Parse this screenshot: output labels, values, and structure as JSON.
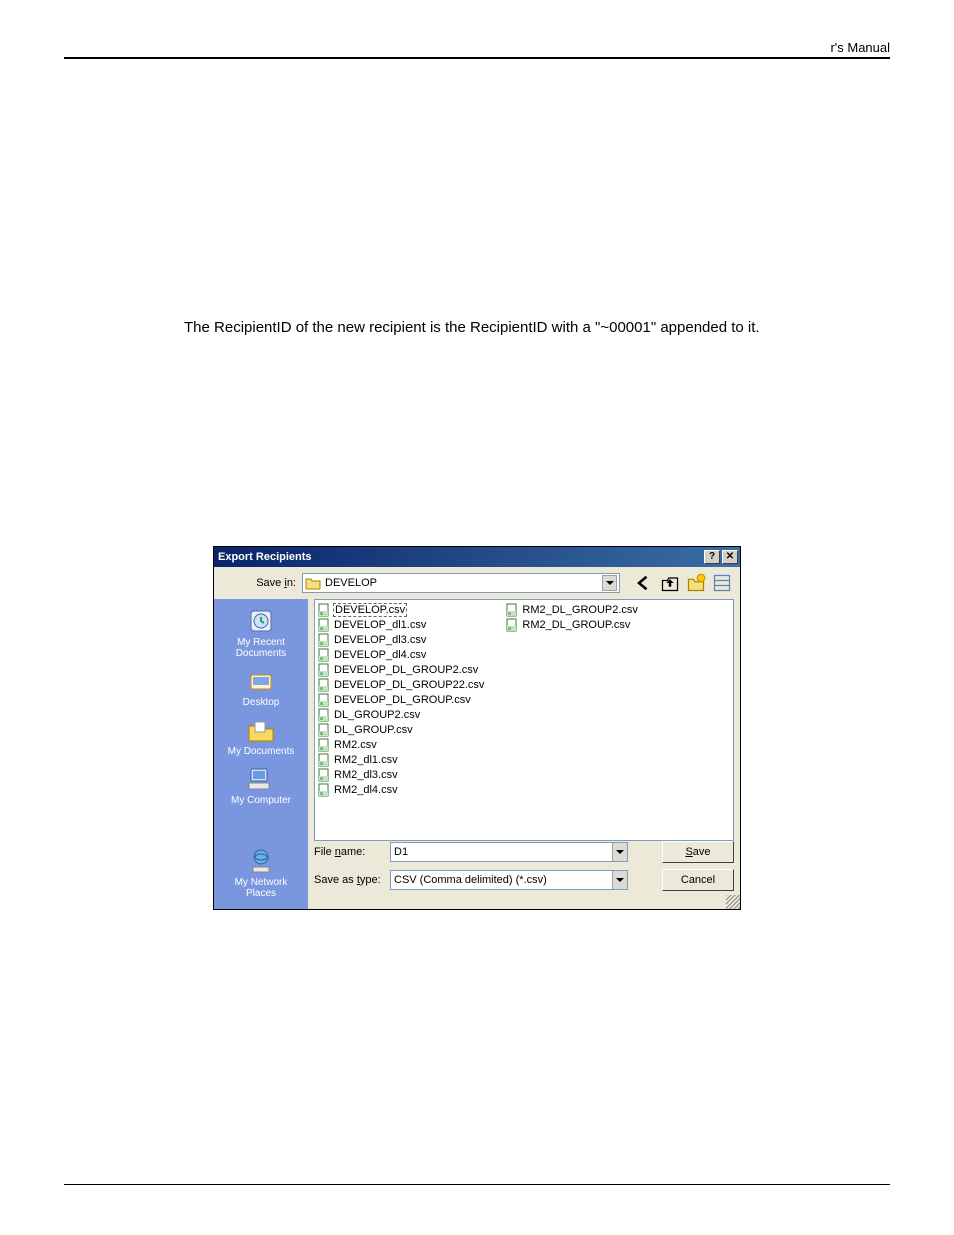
{
  "header": {
    "right_text": "r's Manual"
  },
  "body": {
    "paragraph": "The RecipientID of the new recipient is the RecipientID with a \"~00001\" appended to it."
  },
  "dialog": {
    "title": "Export Recipients",
    "save_in_label": "Save in:",
    "save_in_value": "DEVELOP",
    "sidebar": [
      {
        "label": "My Recent\nDocuments",
        "icon": "recent"
      },
      {
        "label": "Desktop",
        "icon": "desktop"
      },
      {
        "label": "My Documents",
        "icon": "documents"
      },
      {
        "label": "My Computer",
        "icon": "computer"
      }
    ],
    "sidebar_bottom": {
      "label": "My Network\nPlaces",
      "icon": "network"
    },
    "files_col1": [
      "DEVELOP.csv",
      "DEVELOP_dl1.csv",
      "DEVELOP_dl3.csv",
      "DEVELOP_dl4.csv",
      "DEVELOP_DL_GROUP2.csv",
      "DEVELOP_DL_GROUP22.csv",
      "DEVELOP_DL_GROUP.csv",
      "DL_GROUP2.csv",
      "DL_GROUP.csv",
      "RM2.csv",
      "RM2_dl1.csv",
      "RM2_dl3.csv",
      "RM2_dl4.csv"
    ],
    "files_col2": [
      "RM2_DL_GROUP2.csv",
      "RM2_DL_GROUP.csv"
    ],
    "selected_file_index": 0,
    "file_name_label": "File name:",
    "file_name_value": "D1",
    "save_as_type_label": "Save as type:",
    "save_as_type_value": "CSV (Comma delimited) (*.csv)",
    "save_btn": "Save",
    "cancel_btn": "Cancel"
  }
}
